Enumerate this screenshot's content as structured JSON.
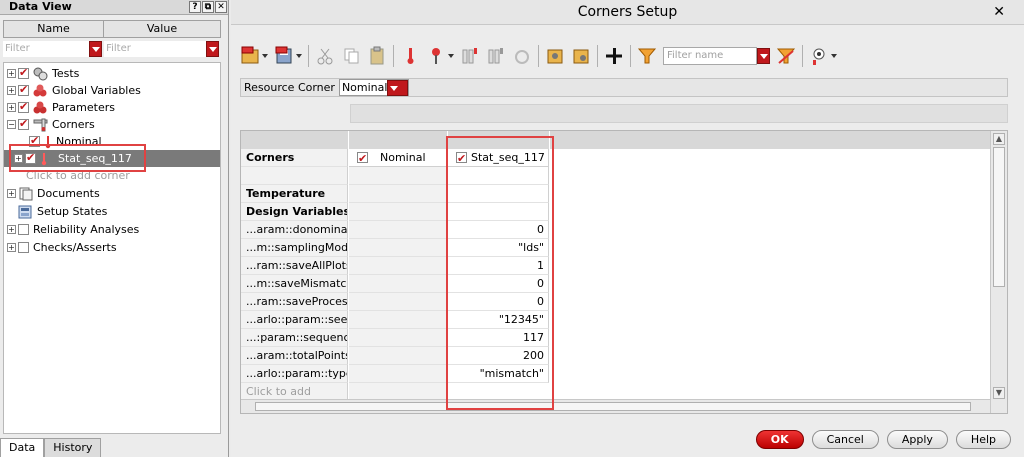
{
  "data_view": {
    "title": "Data View",
    "title_buttons": [
      "?",
      "⧉",
      "✕"
    ],
    "columns": {
      "name": "Name",
      "value": "Value"
    },
    "filter_placeholder": "Filter",
    "tree": [
      {
        "label": "Tests",
        "icon": "tests-icon"
      },
      {
        "label": "Global Variables",
        "icon": "global-variables-icon"
      },
      {
        "label": "Parameters",
        "icon": "parameters-icon"
      },
      {
        "label": "Corners",
        "icon": "corners-icon"
      },
      {
        "label": "Nominal",
        "icon": "thermometer-icon"
      },
      {
        "label": "Stat_seq_117",
        "icon": "thermometer-icon"
      },
      {
        "label": "Click to add corner"
      },
      {
        "label": "Documents",
        "icon": "documents-icon"
      },
      {
        "label": "Setup States",
        "icon": "setup-states-icon"
      },
      {
        "label": "Reliability Analyses"
      },
      {
        "label": "Checks/Asserts"
      }
    ],
    "tabs": [
      "Data",
      "History"
    ]
  },
  "dialog": {
    "title": "Corners Setup",
    "close": "✕",
    "toolbar": {
      "filter_placeholder": "Filter name"
    },
    "resource_corner": {
      "label": "Resource Corner",
      "value": "Nominal"
    },
    "grid": {
      "corners_label": "Corners",
      "col1": "Nominal",
      "col2": "Stat_seq_117",
      "rows": [
        {
          "label": "Temperature",
          "bold": true,
          "value": ""
        },
        {
          "label": "Design Variables",
          "bold": true,
          "value": ""
        },
        {
          "label": "...aram::donominal",
          "value": "0"
        },
        {
          "label": "...m::samplingMode",
          "value": "\"lds\""
        },
        {
          "label": "...ram::saveAllPlots",
          "value": "1"
        },
        {
          "label": "...m::saveMismatch",
          "value": "0"
        },
        {
          "label": "...ram::saveProcess",
          "value": "0"
        },
        {
          "label": "...arlo::param::seed",
          "value": "\"12345\""
        },
        {
          "label": "...:param::sequence",
          "value": "117"
        },
        {
          "label": "...aram::totalPoints",
          "value": "200"
        },
        {
          "label": "...arlo::param::type",
          "value": "\"mismatch\""
        }
      ],
      "add_label": "Click to add"
    },
    "buttons": {
      "ok": "OK",
      "cancel": "Cancel",
      "apply": "Apply",
      "help": "Help"
    }
  },
  "colors": {
    "accent_red": "#c0181c",
    "highlight": "#e04242",
    "selected_row": "#7a7a7a"
  }
}
